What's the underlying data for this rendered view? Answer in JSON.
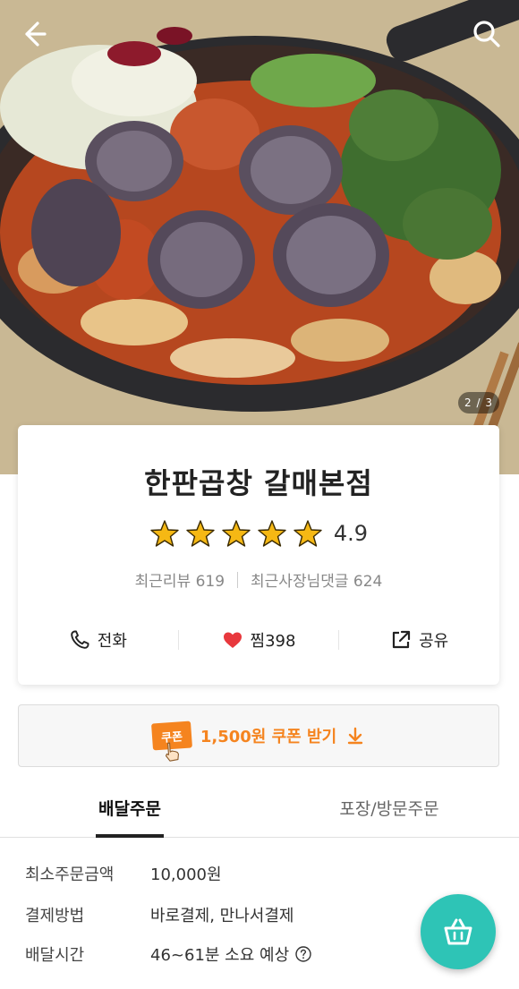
{
  "hero": {
    "image_counter": "2 / 3",
    "back_icon": "arrow-left-icon",
    "search_icon": "search-icon"
  },
  "store": {
    "name": "한판곱창 갈매본점",
    "rating": "4.9",
    "stars_filled": 5,
    "recent_reviews": "최근리뷰 619",
    "recent_owner_replies": "최근사장님댓글 624"
  },
  "actions": {
    "call_label": "전화",
    "favorite_label": "찜",
    "favorite_count": "398",
    "share_label": "공유"
  },
  "coupon": {
    "badge": "쿠폰",
    "label": "1,500원 쿠폰 받기"
  },
  "tabs": [
    {
      "label": "배달주문",
      "active": true
    },
    {
      "label": "포장/방문주문",
      "active": false
    }
  ],
  "details": {
    "min_order_label": "최소주문금액",
    "min_order_value": "10,000원",
    "payment_label": "결제방법",
    "payment_value": "바로결제, 만나서결제",
    "delivery_time_label": "배달시간",
    "delivery_time_value": "46~61분 소요 예상"
  },
  "colors": {
    "accent_orange": "#f5841f",
    "star_yellow": "#f5b814",
    "heart_red": "#e8383d",
    "cart_teal": "#2ec4b6"
  }
}
